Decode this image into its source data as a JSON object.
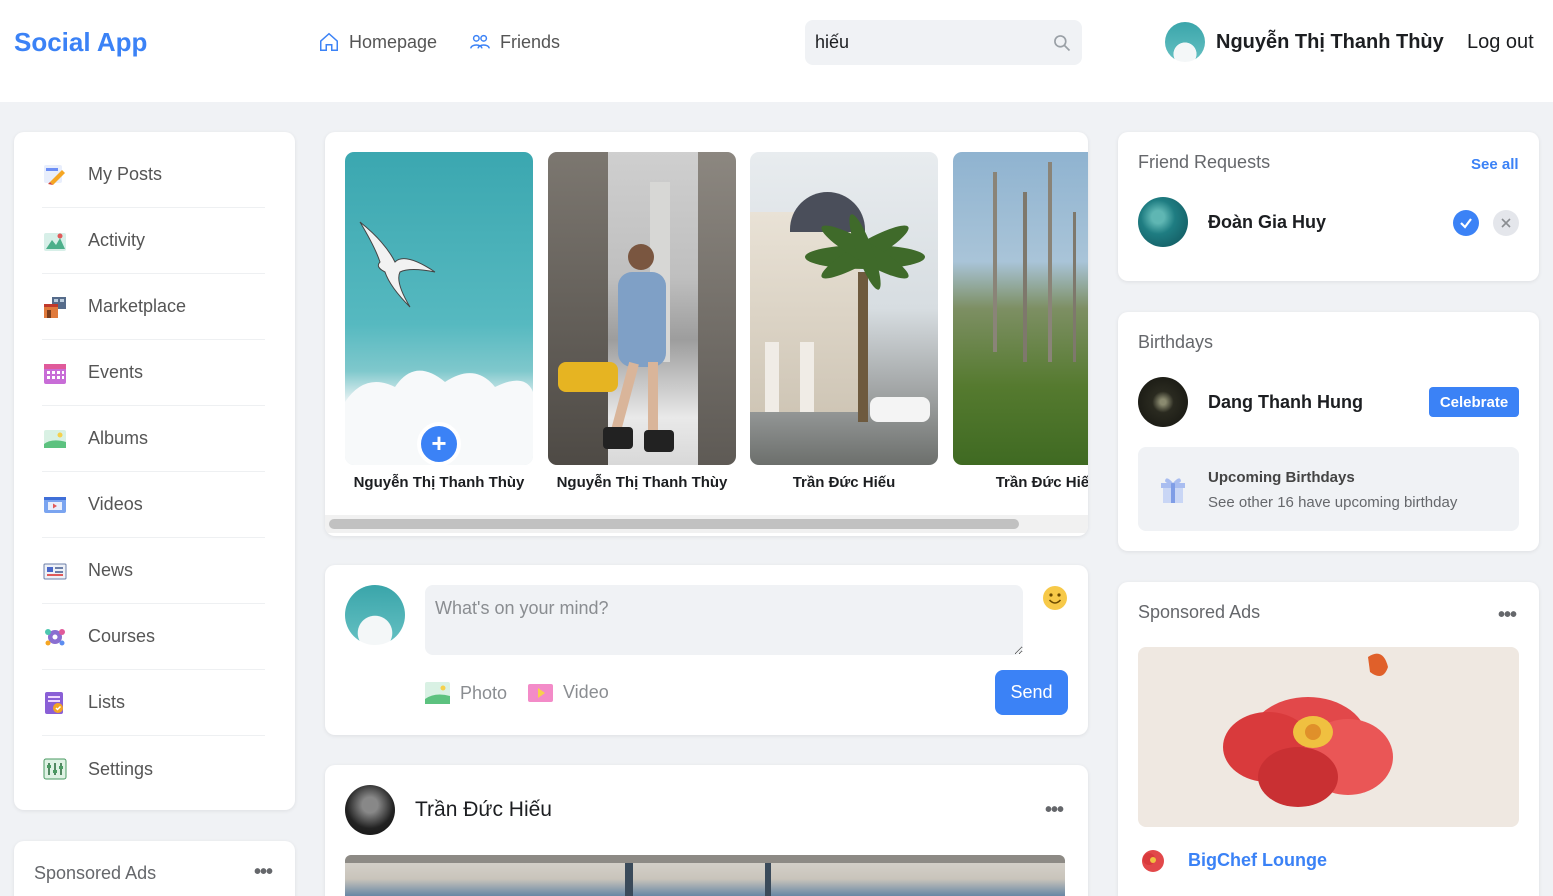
{
  "header": {
    "logo": "Social App",
    "nav": [
      {
        "label": "Homepage",
        "icon": "home-icon"
      },
      {
        "label": "Friends",
        "icon": "friends-icon"
      }
    ],
    "search": {
      "value": "hiếu",
      "placeholder": "Search"
    },
    "user_name": "Nguyễn Thị Thanh Thùy",
    "logout_label": "Log out"
  },
  "sidebar": {
    "items": [
      {
        "label": "My Posts",
        "icon": "my-posts-icon"
      },
      {
        "label": "Activity",
        "icon": "activity-icon"
      },
      {
        "label": "Marketplace",
        "icon": "marketplace-icon"
      },
      {
        "label": "Events",
        "icon": "events-icon"
      },
      {
        "label": "Albums",
        "icon": "albums-icon"
      },
      {
        "label": "Videos",
        "icon": "videos-icon"
      },
      {
        "label": "News",
        "icon": "news-icon"
      },
      {
        "label": "Courses",
        "icon": "courses-icon"
      },
      {
        "label": "Lists",
        "icon": "lists-icon"
      },
      {
        "label": "Settings",
        "icon": "settings-icon"
      }
    ]
  },
  "sponsored_left": {
    "title": "Sponsored Ads"
  },
  "stories": [
    {
      "name": "Nguyễn Thị Thanh Thùy",
      "add": "+"
    },
    {
      "name": "Nguyễn Thị Thanh Thùy"
    },
    {
      "name": "Trần Đức Hiếu"
    },
    {
      "name": "Trần Đức Hiếu"
    }
  ],
  "composer": {
    "placeholder": "What's on your mind?",
    "photo_label": "Photo",
    "video_label": "Video",
    "send_label": "Send"
  },
  "post": {
    "author": "Trần Đức Hiếu"
  },
  "friend_requests": {
    "title": "Friend Requests",
    "see_all": "See all",
    "requests": [
      {
        "name": "Đoàn Gia Huy"
      }
    ]
  },
  "birthdays": {
    "title": "Birthdays",
    "person": "Dang Thanh Hung",
    "celebrate_label": "Celebrate",
    "upcoming_title": "Upcoming Birthdays",
    "upcoming_sub": "See other 16 have upcoming birthday"
  },
  "sponsored_right": {
    "title": "Sponsored Ads",
    "brand": "BigChef Lounge"
  },
  "colors": {
    "accent": "#3b82f6",
    "background": "#f0f2f5"
  }
}
